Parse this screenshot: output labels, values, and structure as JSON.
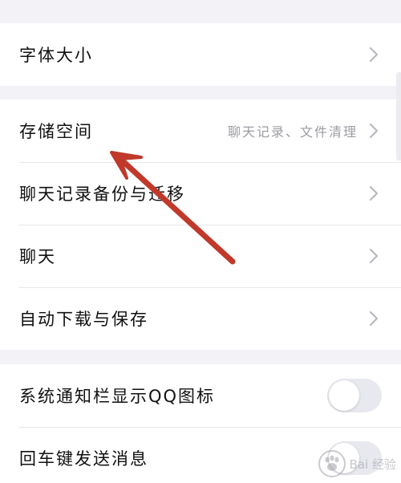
{
  "settings": {
    "font_size": {
      "label": "字体大小"
    },
    "storage": {
      "label": "存储空间",
      "subtext": "聊天记录、文件清理"
    },
    "chat_backup": {
      "label": "聊天记录备份与迁移"
    },
    "chat": {
      "label": "聊天"
    },
    "auto_download": {
      "label": "自动下载与保存"
    },
    "notification_icon": {
      "label": "系统通知栏显示QQ图标",
      "enabled": false
    },
    "enter_send": {
      "label": "回车键发送消息",
      "enabled": false
    }
  },
  "icons": {
    "chevron": "chevron-right-icon",
    "annotation": "red-arrow"
  },
  "colors": {
    "background": "#f2f2f7",
    "row": "#ffffff",
    "annotation_arrow": "#c0392b",
    "toggle_off": "#e8e8ef"
  },
  "watermark": {
    "text": "Bai 经验"
  }
}
